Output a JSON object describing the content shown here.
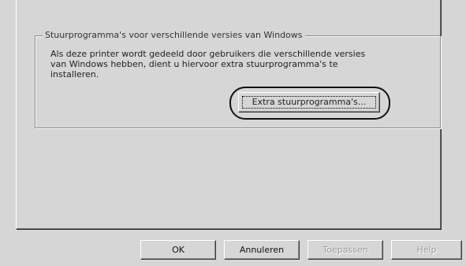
{
  "groupbox": {
    "title": "Stuurprogramma's voor verschillende versies van Windows",
    "description": "Als deze printer wordt gedeeld door gebruikers die verschillende versies van Windows hebben, dient u hiervoor extra stuurprogramma's te installeren."
  },
  "buttons": {
    "extra_drivers": "Extra stuurprogramma's...",
    "ok": "OK",
    "cancel": "Annuleren",
    "apply": "Toepassen",
    "help": "Help"
  }
}
